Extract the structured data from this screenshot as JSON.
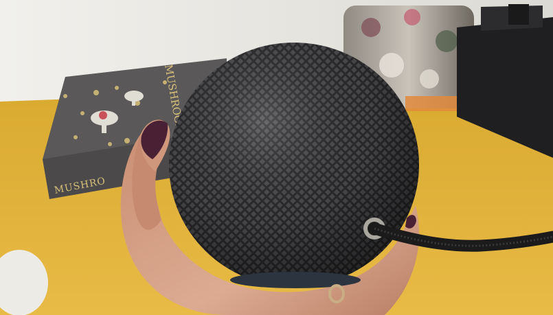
{
  "photo": {
    "subject": "smart-speaker-held-in-hand",
    "book": {
      "spine_text": "MUSHRO",
      "cover_text": "MUSHROOMS"
    },
    "colors": {
      "wall": "#e9e7e2",
      "desk": "#e2b43c",
      "speaker_mesh": "#3b3b3d",
      "book_cover": "#5a5858",
      "nail_polish": "#4a2134",
      "skin": "#d7a48b"
    }
  }
}
